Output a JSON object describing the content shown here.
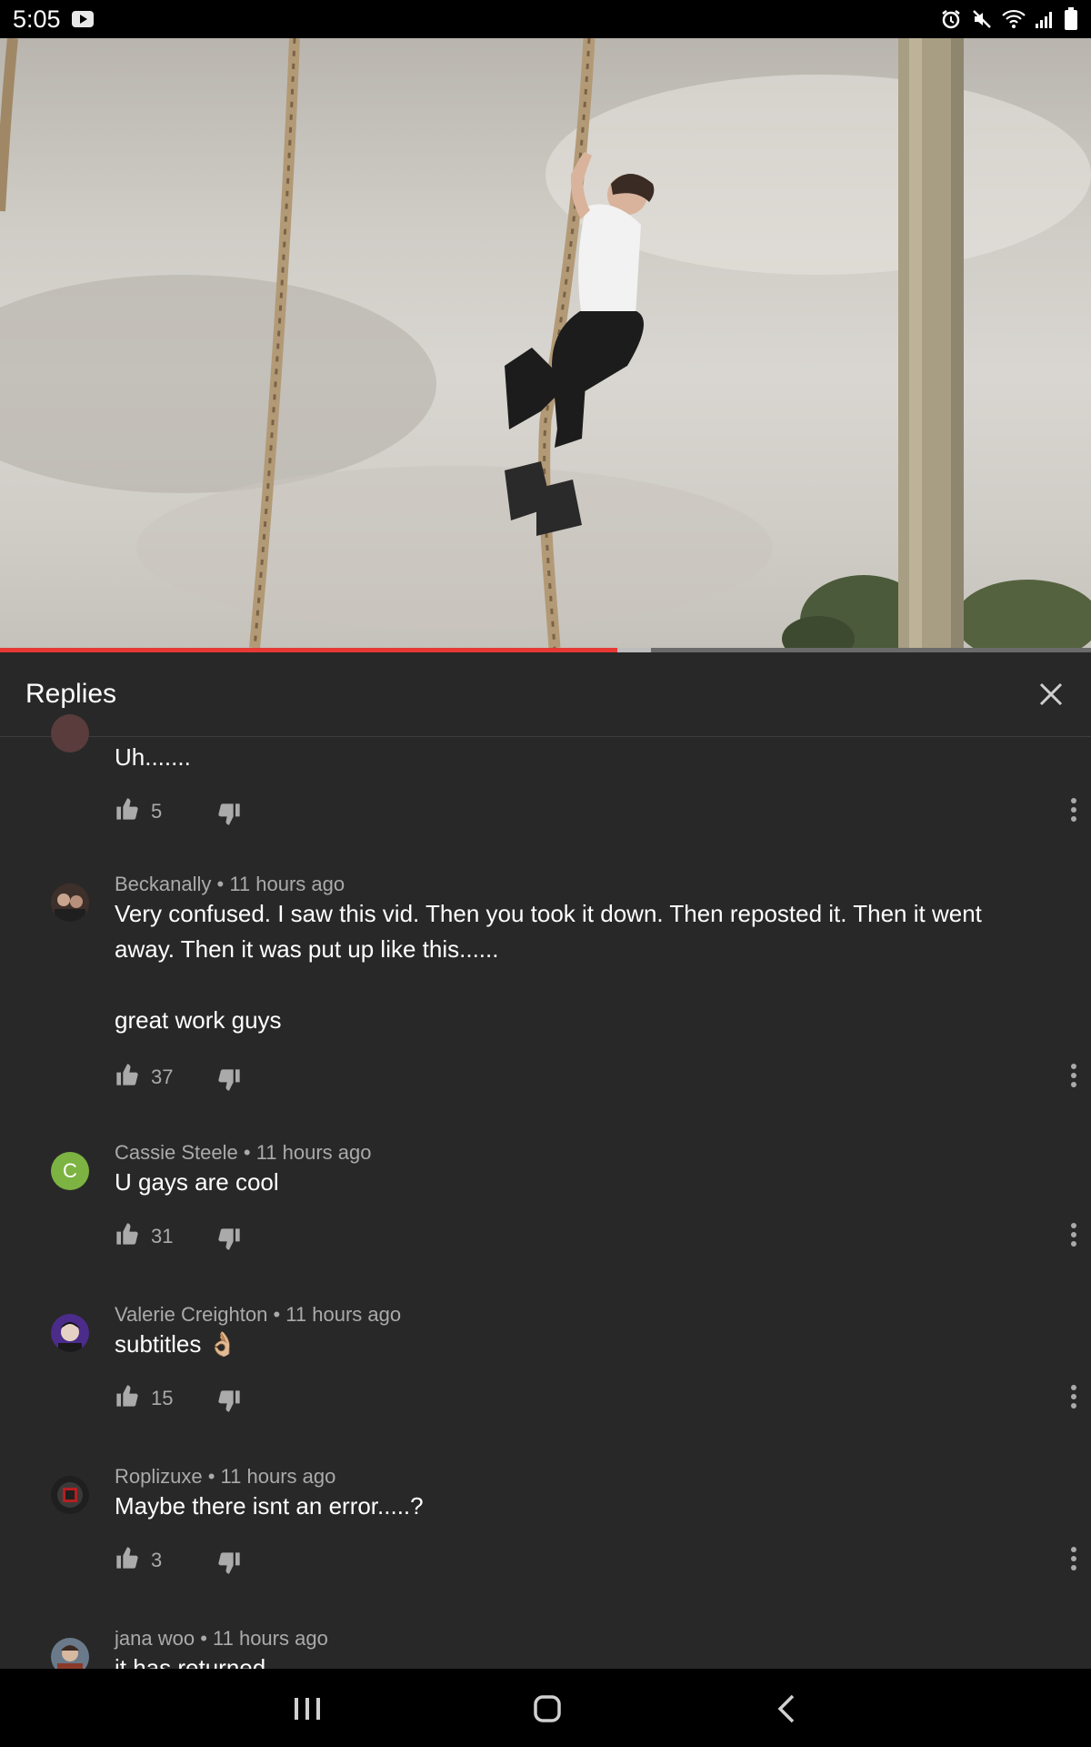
{
  "status": {
    "time": "5:05"
  },
  "video": {
    "progress_fraction": 0.566
  },
  "panel": {
    "title": "Replies"
  },
  "comments": [
    {
      "author": "",
      "time": "",
      "text": "Uh.......",
      "likes": "5"
    },
    {
      "author": "Beckanally",
      "time": "11 hours ago",
      "text_lines": [
        "Very confused. I saw this vid. Then you took it down. Then reposted it. Then it went away. Then it was put up like this......",
        "great work guys"
      ],
      "likes": "37"
    },
    {
      "author": "Cassie Steele",
      "time": "11 hours ago",
      "avatar_letter": "C",
      "text": "U gays are cool",
      "likes": "31"
    },
    {
      "author": "Valerie Creighton",
      "time": "11 hours ago",
      "text": "subtitles 👌🏼",
      "likes": "15"
    },
    {
      "author": "Roplizuxe",
      "time": "11 hours ago",
      "text": "Maybe there isnt an error.....?",
      "likes": "3"
    },
    {
      "author": "jana woo",
      "time": "11 hours ago",
      "text": "it has returned"
    }
  ],
  "meta_separator": " • ",
  "icons": [
    "youtube-icon",
    "alarm-icon",
    "mute-icon",
    "wifi-icon",
    "signal-icon",
    "battery-icon",
    "close-icon",
    "like-icon",
    "dislike-icon",
    "more-options-icon",
    "recent-apps-icon",
    "home-icon",
    "back-icon"
  ],
  "colors": {
    "panel_bg": "#282828",
    "progress": "#e53935",
    "meta_text": "#aaaaaa",
    "avatar_c": "#7cb342"
  }
}
